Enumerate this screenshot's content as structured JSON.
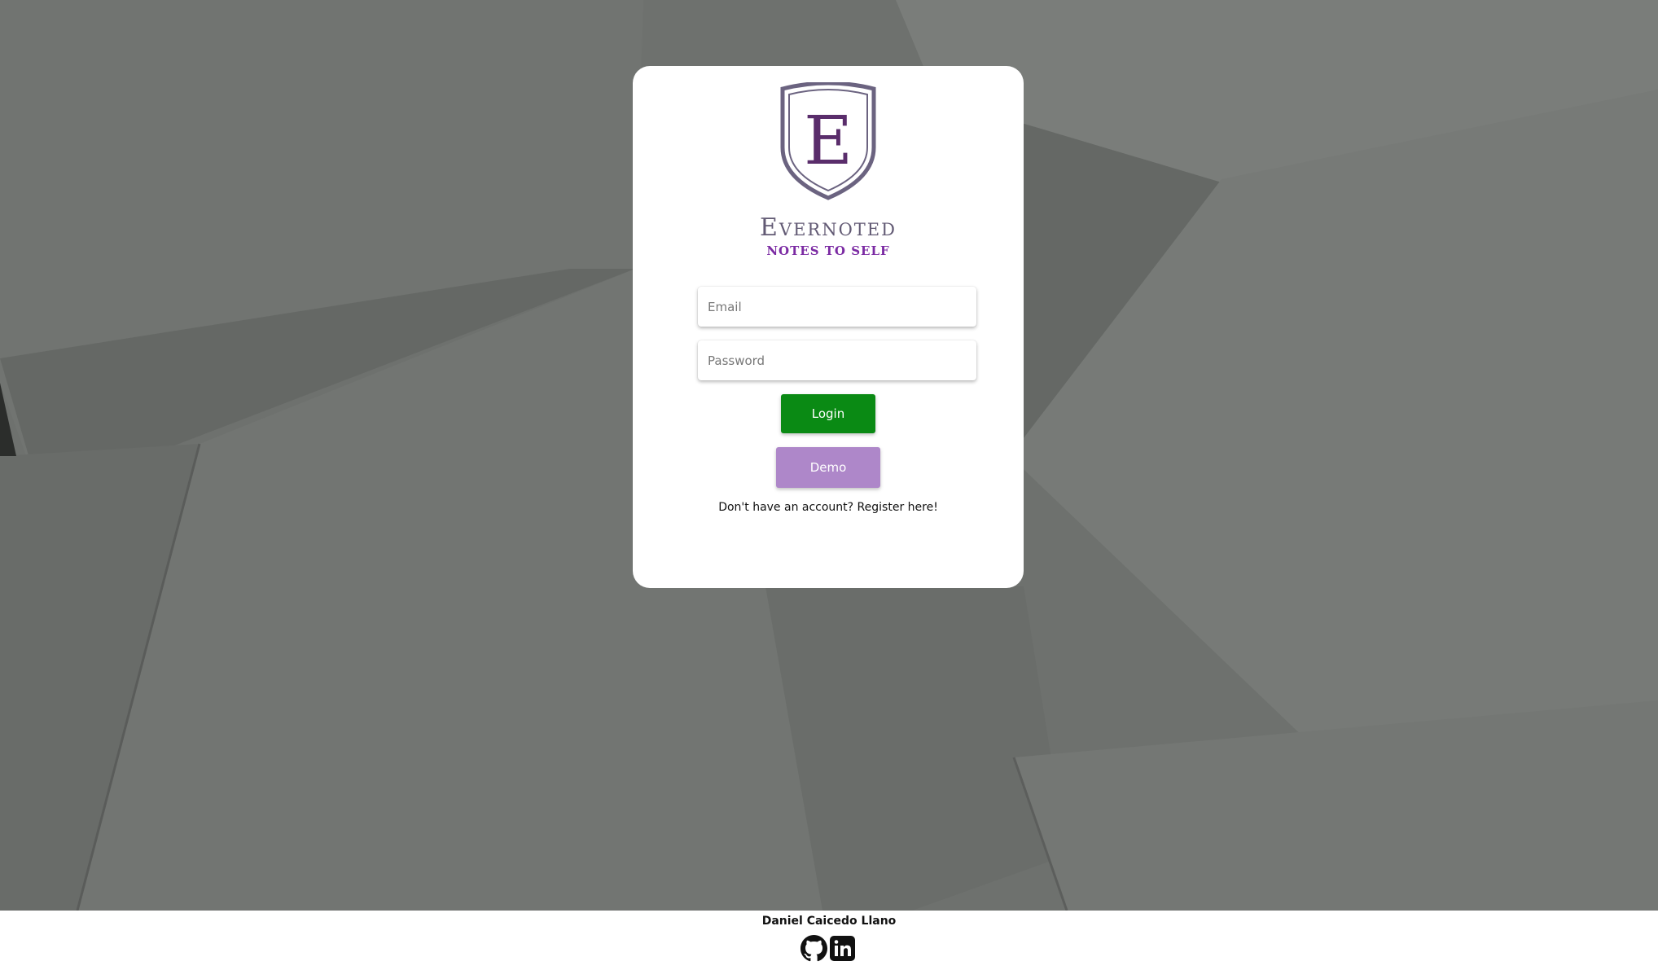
{
  "brand": {
    "logo_letter": "E",
    "name": "Evernoted",
    "tagline": "NOTES TO SELF"
  },
  "login_form": {
    "email_placeholder": "Email",
    "password_placeholder": "Password",
    "login_label": "Login",
    "demo_label": "Demo",
    "register_prompt": "Don't have an account? Register here!"
  },
  "footer": {
    "author": "Daniel Caicedo Llano",
    "links": [
      {
        "icon": "github-icon"
      },
      {
        "icon": "linkedin-icon"
      }
    ]
  },
  "colors": {
    "login_button": "#0a8a14",
    "demo_button": "#ae87c9",
    "brand_purple": "#7b2aa3",
    "logo_gray": "#625a74",
    "background": "#6f726f"
  }
}
